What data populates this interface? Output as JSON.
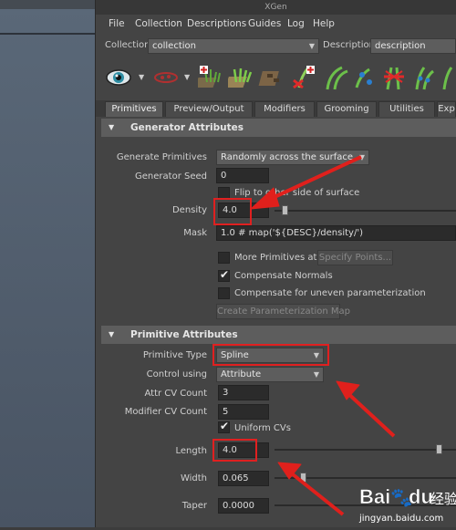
{
  "window": {
    "title": "XGen"
  },
  "menu": [
    "File",
    "Collection",
    "Descriptions",
    "Guides",
    "Log",
    "Help"
  ],
  "collection": {
    "label": "Collection",
    "value": "collection",
    "description_label": "Description",
    "description_value": "description"
  },
  "toolbar_icons": [
    "eye-icon",
    "density-brush-icon",
    "add-primitive-icon",
    "grass-icon",
    "bark-icon",
    "place-guide-icon",
    "guide-curve-icon",
    "guide-bend-icon",
    "guide-cut-icon",
    "guide-length-icon",
    "guide-comb-icon"
  ],
  "tabs": [
    "Primitives",
    "Preview/Output",
    "Modifiers",
    "Grooming",
    "Utilities",
    "Exp"
  ],
  "generator": {
    "title": "Generator Attributes",
    "generate_label": "Generate Primitives",
    "generate_value": "Randomly across the surface",
    "seed_label": "Generator Seed",
    "seed_value": "0",
    "flip_label": "Flip to other side of surface",
    "density_label": "Density",
    "density_value": "4.0",
    "density_level": 0.04,
    "mask_label": "Mask",
    "mask_value": "1.0 # map('${DESC}/density/')",
    "more_label": "More Primitives at",
    "specify_label": "Specify Points...",
    "compensate_label": "Compensate Normals",
    "uneven_label": "Compensate for uneven parameterization",
    "create_map_label": "Create Parameterization Map"
  },
  "primitive": {
    "title": "Primitive Attributes",
    "type_label": "Primitive Type",
    "type_value": "Spline",
    "control_label": "Control using",
    "control_value": "Attribute",
    "attr_cv_label": "Attr CV Count",
    "attr_cv_value": "3",
    "modifier_cv_label": "Modifier CV Count",
    "modifier_cv_value": "5",
    "uniform_label": "Uniform CVs",
    "length_label": "Length",
    "length_value": "4.0",
    "width_label": "Width",
    "width_value": "0.065",
    "taper_label": "Taper",
    "taper_value": "0.0000"
  },
  "watermark": {
    "brand": "Bai",
    "brand_suffix": "du",
    "paw": "🐾",
    "chinese": "经验",
    "url": "jingyan.baidu.com"
  },
  "colors": {
    "highlight": "#e02020",
    "panel": "#444444",
    "section": "#5d5d5d",
    "field": "#2b2b2b"
  }
}
